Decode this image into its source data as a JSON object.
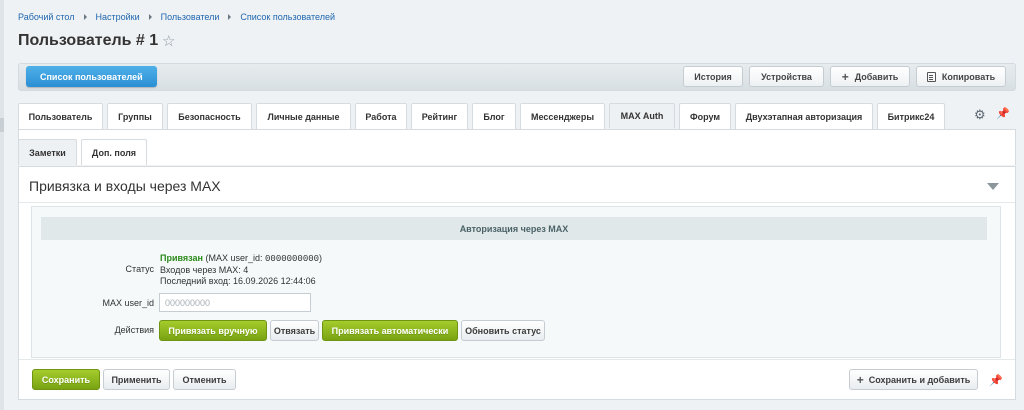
{
  "breadcrumbs": [
    "Рабочий стол",
    "Настройки",
    "Пользователи",
    "Список пользователей"
  ],
  "page_title": "Пользователь # 1",
  "toolbar": {
    "list_users": "Список пользователей",
    "history": "История",
    "devices": "Устройства",
    "add": "Добавить",
    "copy": "Копировать"
  },
  "tabs": [
    "Пользователь",
    "Группы",
    "Безопасность",
    "Личные данные",
    "Работа",
    "Рейтинг",
    "Блог",
    "Мессенджеры",
    "MAX Auth",
    "Форум",
    "Двухэтапная авторизация",
    "Битрикс24"
  ],
  "active_tab": "MAX Auth",
  "subtabs": [
    "Заметки",
    "Доп. поля"
  ],
  "section": {
    "title": "Привязка и входы через MAX",
    "header": "Авторизация через MAX",
    "status_label": "Статус",
    "status_value": "Привязан",
    "status_id_prefix": "(MAX user_id: ",
    "status_id": "0000000000",
    "status_id_suffix": ")",
    "logins_line": "Входов через MAX: 4",
    "last_login_line": "Последний вход: 16.09.2026 12:44:06",
    "maxid_label": "MAX user_id",
    "maxid_placeholder": "000000000",
    "maxid_value": "",
    "actions_label": "Действия",
    "actions": {
      "bind_manual": "Привязать вручную",
      "unbind": "Отвязать",
      "bind_auto": "Привязать автоматически",
      "refresh_status": "Обновить статус"
    }
  },
  "footer": {
    "save": "Сохранить",
    "apply": "Применить",
    "cancel": "Отменить",
    "save_and_add": "Сохранить и добавить"
  },
  "colors": {
    "accent_blue": "#2a8fd4",
    "accent_green": "#79a312",
    "status_green": "#2a8a1a",
    "link": "#2067b0"
  }
}
